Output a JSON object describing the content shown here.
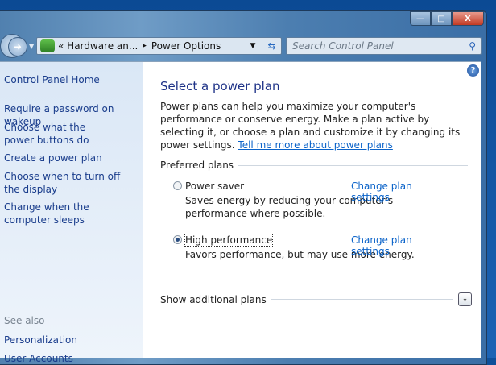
{
  "window": {
    "minimize": "—",
    "maximize": "□",
    "close": "X"
  },
  "address": {
    "prefix": "«",
    "crumbs": [
      "Hardware an...",
      "Power Options"
    ],
    "sep": "▸"
  },
  "search": {
    "placeholder": "Search Control Panel"
  },
  "sidebar": {
    "links": [
      "Control Panel Home",
      "Require a password on wakeup",
      "Choose what the power buttons do",
      "Create a power plan",
      "Choose when to turn off the display",
      "Change when the computer sleeps"
    ],
    "see_also": "See also",
    "see_also_links": [
      "Personalization",
      "User Accounts"
    ]
  },
  "main": {
    "title": "Select a power plan",
    "intro": "Power plans can help you maximize your computer's performance or conserve energy. Make a plan active by selecting it, or choose a plan and customize it by changing its power settings.",
    "intro_link": "Tell me more about power plans",
    "group_label": "Preferred plans",
    "plans": [
      {
        "name": "Power saver",
        "desc": "Saves energy by reducing your computer's performance where possible.",
        "link": "Change plan settings",
        "selected": false
      },
      {
        "name": "High performance",
        "desc": "Favors performance, but may use more energy.",
        "link": "Change plan settings",
        "selected": true
      }
    ],
    "show_more": "Show additional plans"
  }
}
